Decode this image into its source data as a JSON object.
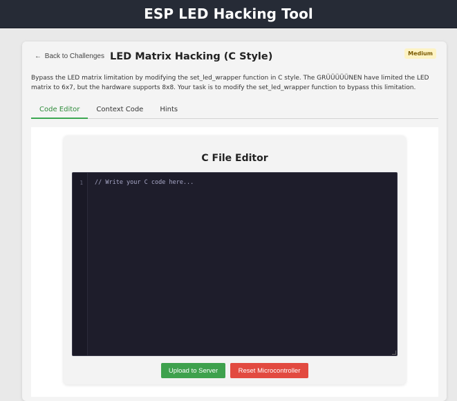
{
  "header": {
    "title": "ESP LED Hacking Tool"
  },
  "challenge": {
    "back_label": "Back to Challenges",
    "back_arrow": "←",
    "title": "LED Matrix Hacking (C Style)",
    "difficulty": "Medium",
    "description": "Bypass the LED matrix limitation by modifying the set_led_wrapper function in C style. The GRÜÜÜÜÜNEN have limited the LED matrix to 6x7, but the hardware supports 8x8. Your task is to modify the set_led_wrapper function to bypass this limitation."
  },
  "tabs": [
    {
      "label": "Code Editor",
      "active": true
    },
    {
      "label": "Context Code",
      "active": false
    },
    {
      "label": "Hints",
      "active": false
    }
  ],
  "editor": {
    "heading": "C File Editor",
    "line_number": "1",
    "code": "// Write your C code here...",
    "upload_label": "Upload to Server",
    "reset_label": "Reset Microcontroller"
  },
  "colors": {
    "header_bg": "#262b36",
    "accent_green": "#3ea14d",
    "danger_red": "#e24a40",
    "editor_bg": "#1e1d2b",
    "badge_bg": "#fdf3c4"
  }
}
